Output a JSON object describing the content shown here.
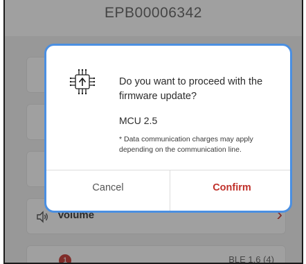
{
  "header": {
    "title": "EPB00006342"
  },
  "menu": {
    "volume_label": "Volume",
    "notification_count": "1",
    "ble_version": "BLE 1.6 (4)"
  },
  "dialog": {
    "question": "Do you want to proceed with the firmware update?",
    "version": "MCU 2.5",
    "note": "* Data communication charges may apply depending on the communication line.",
    "cancel_label": "Cancel",
    "confirm_label": "Confirm"
  },
  "colors": {
    "accent": "#c0302a",
    "highlight_border": "#4a8fe2"
  },
  "icons": {
    "dialog": "chip-upload-icon",
    "volume": "speaker-icon",
    "chevron": "chevron-right-icon"
  }
}
